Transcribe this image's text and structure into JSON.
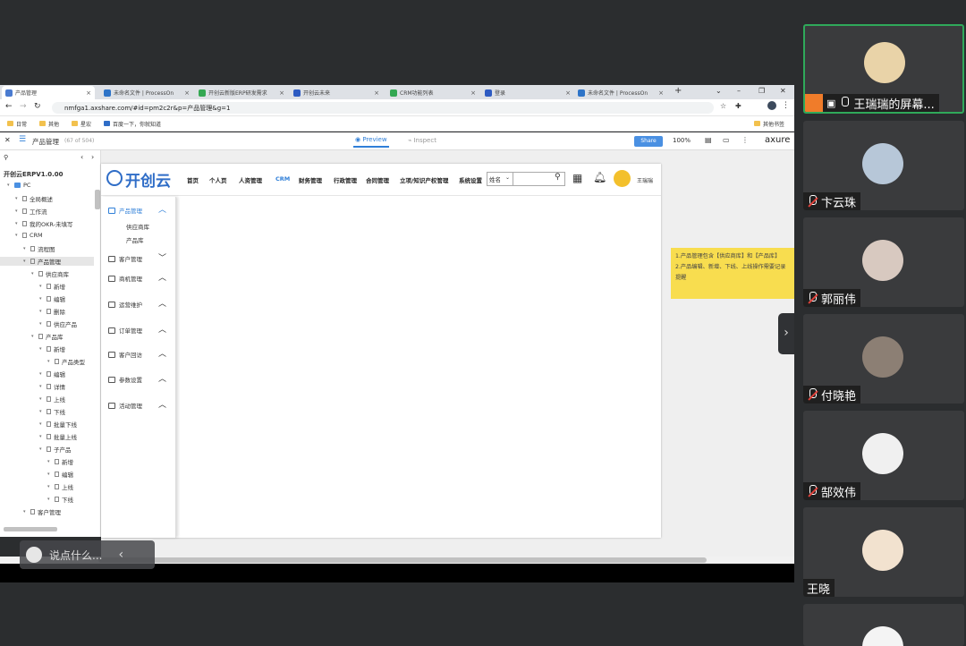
{
  "browser": {
    "tabs": [
      {
        "label": "产品管理",
        "color": "#4a7bd0"
      },
      {
        "label": "未命名文件 | ProcessOn",
        "color": "#2e74c8"
      },
      {
        "label": "开创云新版ERP研发需求",
        "color": "#34a853"
      },
      {
        "label": "开创云未来",
        "color": "#2e5bc2"
      },
      {
        "label": "CRM功能列表",
        "color": "#34a853"
      },
      {
        "label": "登录",
        "color": "#2e5bc2"
      },
      {
        "label": "未命名文件 | ProcessOn",
        "color": "#2e74c8"
      }
    ],
    "url": "nmfga1.axshare.com/#id=pm2c2r&p=产品管理&g=1",
    "bookmarks": [
      "日常",
      "其他",
      "星宏",
      "百度一下，你就知道"
    ],
    "other_bookmarks": "其他书签"
  },
  "axure": {
    "page_title": "产品管理",
    "page_count": "(67 of 504)",
    "preview_label": "Preview",
    "inspect_label": "Inspect",
    "share_label": "Share",
    "zoom": "100%",
    "logo": "axure",
    "project": "开创云ERPV1.0.00",
    "tree": [
      {
        "label": "PC",
        "indent": 0,
        "type": "folder"
      },
      {
        "label": "全局概述",
        "indent": 1,
        "type": "page"
      },
      {
        "label": "工作流",
        "indent": 1,
        "type": "page"
      },
      {
        "label": "我的OKR-未填写",
        "indent": 1,
        "type": "page"
      },
      {
        "label": "CRM",
        "indent": 1,
        "type": "page"
      },
      {
        "label": "流程图",
        "indent": 2,
        "type": "page"
      },
      {
        "label": "产品管理",
        "indent": 2,
        "type": "page",
        "selected": true
      },
      {
        "label": "供应商库",
        "indent": 3,
        "type": "page"
      },
      {
        "label": "新增",
        "indent": 4,
        "type": "page"
      },
      {
        "label": "编辑",
        "indent": 4,
        "type": "page"
      },
      {
        "label": "删除",
        "indent": 4,
        "type": "page"
      },
      {
        "label": "供应产品",
        "indent": 4,
        "type": "page"
      },
      {
        "label": "产品库",
        "indent": 3,
        "type": "page"
      },
      {
        "label": "新增",
        "indent": 4,
        "type": "page"
      },
      {
        "label": "产品类型",
        "indent": 5,
        "type": "page"
      },
      {
        "label": "编辑",
        "indent": 4,
        "type": "page"
      },
      {
        "label": "详情",
        "indent": 4,
        "type": "page"
      },
      {
        "label": "上线",
        "indent": 4,
        "type": "page"
      },
      {
        "label": "下线",
        "indent": 4,
        "type": "page"
      },
      {
        "label": "批量下线",
        "indent": 4,
        "type": "page"
      },
      {
        "label": "批量上线",
        "indent": 4,
        "type": "page"
      },
      {
        "label": "子产品",
        "indent": 4,
        "type": "page"
      },
      {
        "label": "新增",
        "indent": 5,
        "type": "page"
      },
      {
        "label": "编辑",
        "indent": 5,
        "type": "page"
      },
      {
        "label": "上线",
        "indent": 5,
        "type": "page"
      },
      {
        "label": "下线",
        "indent": 5,
        "type": "page"
      },
      {
        "label": "客户管理",
        "indent": 2,
        "type": "page"
      }
    ]
  },
  "prototype": {
    "brand": "开创云",
    "nav": [
      "首页",
      "个人页",
      "人资管理",
      "CRM",
      "财务管理",
      "行政管理",
      "合同管理",
      "立项/知识产权管理",
      "系统设置"
    ],
    "active_nav": "CRM",
    "search_select": "姓名",
    "username": "王瑞瑞",
    "menu": [
      {
        "label": "产品管理",
        "chevron": "up",
        "active": true
      },
      {
        "label": "客户管理",
        "chevron": "down"
      },
      {
        "label": "商机管理",
        "chevron": "up"
      },
      {
        "label": "运营维护",
        "chevron": "up"
      },
      {
        "label": "订单管理",
        "chevron": "up"
      },
      {
        "label": "客户回访",
        "chevron": "up"
      },
      {
        "label": "参数设置",
        "chevron": "up"
      },
      {
        "label": "活动管理",
        "chevron": "up"
      }
    ],
    "submenu": [
      "供应商库",
      "产品库"
    ]
  },
  "note": {
    "line1": "1.产品管理包含【供应商库】和【产品库】",
    "line2": "2.产品编辑、新增、下线、上线操作需要记录",
    "line3": "提醒"
  },
  "chat": {
    "placeholder": "说点什么..."
  },
  "participants": [
    {
      "name": "王瑞瑞的屏幕...",
      "muted": false,
      "sharing": true,
      "color": "#e9d3a8"
    },
    {
      "name": "卞云珠",
      "muted": true,
      "color": "#b7c7d8"
    },
    {
      "name": "郭丽伟",
      "muted": true,
      "color": "#d8c9c0"
    },
    {
      "name": "付晓艳",
      "muted": true,
      "color": "#8c7f74"
    },
    {
      "name": "郜效伟",
      "muted": true,
      "color": "#f0f0f0"
    },
    {
      "name": "王晓",
      "muted": false,
      "hide_mic": true,
      "color": "#f2e2cf"
    },
    {
      "name": "",
      "muted": false,
      "hide_mic": true,
      "color": "#f4f4f4"
    }
  ],
  "colors": {
    "accent": "#2f7fd8",
    "note": "#f8dd4f",
    "active_speaker": "#2fa95a",
    "muted": "#e0413a"
  }
}
